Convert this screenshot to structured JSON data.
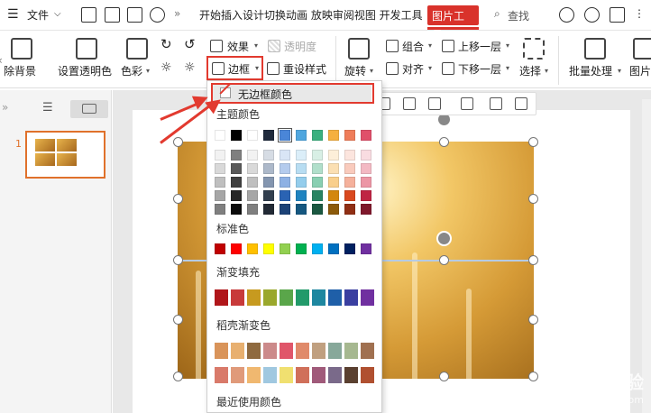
{
  "menubar": {
    "file": "文件",
    "tabs_text": "开始插入设计切换动画 放映审阅视图 开发工具",
    "active_tab": "图片工具",
    "search": "查找"
  },
  "ribbon": {
    "remove_bg": "除背景",
    "set_transparent": "设置透明色",
    "color": "色彩",
    "effect": "效果",
    "transparency": "透明度",
    "border": "边框",
    "reset_style": "重设样式",
    "rotate": "旋转",
    "group": "组合",
    "align": "对齐",
    "bring_forward": "上移一层",
    "send_backward": "下移一层",
    "select": "选择",
    "batch": "批量处理",
    "picture": "图片"
  },
  "slides": {
    "number": "1"
  },
  "dropdown": {
    "no_border": "无边框颜色",
    "theme_colors": "主题颜色",
    "standard_colors": "标准色",
    "gradient_fill": "渐变填充",
    "shell_gradient": "稻壳渐变色",
    "recent_colors": "最近使用颜色",
    "theme_top": [
      "#ffffff",
      "#000000",
      "#ffffff",
      "#1f2a3c",
      "#4a86d8",
      "#4fa6df",
      "#3bb07f",
      "#f5b040",
      "#ef7d5a",
      "#e0506a"
    ],
    "standard": [
      "#c00000",
      "#ff0000",
      "#ffc000",
      "#ffff00",
      "#92d050",
      "#00b050",
      "#00b0f0",
      "#0070c0",
      "#002060",
      "#7030a0"
    ],
    "gradients": [
      "#b0161a",
      "#c83a3a",
      "#c79a1f",
      "#9aa82c",
      "#5aa64a",
      "#229a6a",
      "#1e87a0",
      "#1f5fa8",
      "#3a3fa0",
      "#7030a0"
    ],
    "shell1": [
      "#d9945a",
      "#e8b070",
      "#8f6a3f",
      "#cc8a8a",
      "#e0566a",
      "#e08a6a",
      "#c0a080",
      "#87a89a",
      "#a6b890",
      "#a07050"
    ],
    "shell2": [
      "#d97a6a",
      "#e09a7a",
      "#f0b870",
      "#a0c8e0",
      "#f0e070",
      "#d0705a",
      "#a05a7a",
      "#7a6a8a",
      "#5a4030",
      "#b05030"
    ]
  },
  "watermark": {
    "logo": "Bai 经验",
    "url": "jingyan.baidu.com"
  }
}
